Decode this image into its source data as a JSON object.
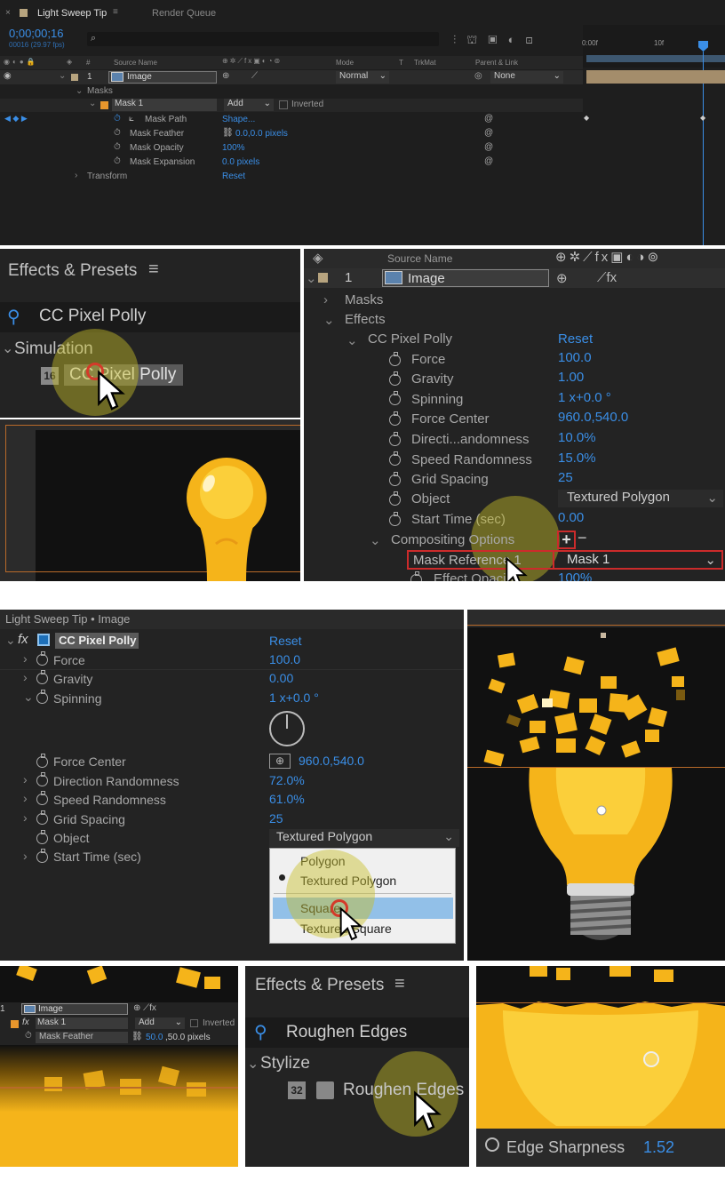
{
  "timeline": {
    "tab_close": "×",
    "tab_name": "Light Sweep Tip",
    "tab_menu": "≡",
    "tab_render": "Render Queue",
    "timecode": "0;00;00;16",
    "frames": "00016 (29.97 fps)",
    "search_placeholder": "",
    "ruler": [
      "0:00f",
      "10f"
    ],
    "col_hash": "#",
    "col_source": "Source Name",
    "col_mode": "Mode",
    "col_t": "T",
    "col_trkmat": "TrkMat",
    "col_parent": "Parent & Link",
    "layer_num": "1",
    "layer_name": "Image",
    "layer_mode": "Normal",
    "layer_parent": "None",
    "masks_label": "Masks",
    "mask1": "Mask 1",
    "mask1_mode": "Add",
    "inverted": "Inverted",
    "props": [
      {
        "name": "Mask Path",
        "value": "Shape..."
      },
      {
        "name": "Mask Feather",
        "value": "0.0,0.0 pixels"
      },
      {
        "name": "Mask Opacity",
        "value": "100%"
      },
      {
        "name": "Mask Expansion",
        "value": "0.0 pixels"
      }
    ],
    "transform": "Transform",
    "transform_reset": "Reset"
  },
  "effects1": {
    "title": "Effects & Presets",
    "search": "CC Pixel Polly",
    "category": "Simulation",
    "badge": "16",
    "item": "CC Pixel Polly"
  },
  "tl2": {
    "col_source": "Source Name",
    "layer_num": "1",
    "layer_name": "Image",
    "masks": "Masks",
    "effects": "Effects",
    "effect": "CC Pixel Polly",
    "reset": "Reset",
    "props": [
      {
        "name": "Force",
        "value": "100.0"
      },
      {
        "name": "Gravity",
        "value": "1.00"
      },
      {
        "name": "Spinning",
        "value": "1 x+0.0 °"
      },
      {
        "name": "Force Center",
        "value": "960.0,540.0"
      },
      {
        "name": "Directi...andomness",
        "value": "10.0%"
      },
      {
        "name": "Speed Randomness",
        "value": "15.0%"
      },
      {
        "name": "Grid Spacing",
        "value": "25"
      },
      {
        "name": "Object",
        "value": "Textured Polygon"
      },
      {
        "name": "Start Time (sec)",
        "value": "0.00"
      }
    ],
    "compositing": "Compositing Options",
    "mask_ref": "Mask Reference 1",
    "mask_ref_value": "Mask 1",
    "effect_opacity": "Effect Opacity",
    "effect_opacity_value": "100%"
  },
  "ec": {
    "title": "Light Sweep Tip • Image",
    "effect": "CC Pixel Polly",
    "reset": "Reset",
    "props": [
      {
        "name": "Force",
        "value": "100.0"
      },
      {
        "name": "Gravity",
        "value": "0.00"
      },
      {
        "name": "Spinning",
        "value": "1 x+0.0 °"
      },
      {
        "name": "Force Center",
        "value": "960.0,540.0"
      },
      {
        "name": "Direction Randomness",
        "value": "72.0%"
      },
      {
        "name": "Speed Randomness",
        "value": "61.0%"
      },
      {
        "name": "Grid Spacing",
        "value": "25"
      },
      {
        "name": "Object",
        "value": "Textured Polygon"
      },
      {
        "name": "Start Time (sec)",
        "value": ""
      }
    ],
    "options": [
      "Polygon",
      "Textured Polygon",
      "Square",
      "Textured Square"
    ]
  },
  "tl3": {
    "layer_num": "1",
    "layer_name": "Image",
    "mask": "Mask 1",
    "mask_mode": "Add",
    "inverted": "Inverted",
    "prop": "Mask Feather",
    "value_a": "50.0",
    "value_b": ",50.0 pixels"
  },
  "effects2": {
    "title": "Effects & Presets",
    "search": "Roughen Edges",
    "category": "Stylize",
    "badge1": "32",
    "item": "Roughen Edges"
  },
  "edge": {
    "label": "Edge Sharpness",
    "value": "1.52"
  },
  "colors": {
    "accent": "#3a8ee6",
    "bulb": "#f5b41a",
    "panel": "#232323",
    "selection": "#92c0e8",
    "highlight_red": "#cc2b2b"
  }
}
